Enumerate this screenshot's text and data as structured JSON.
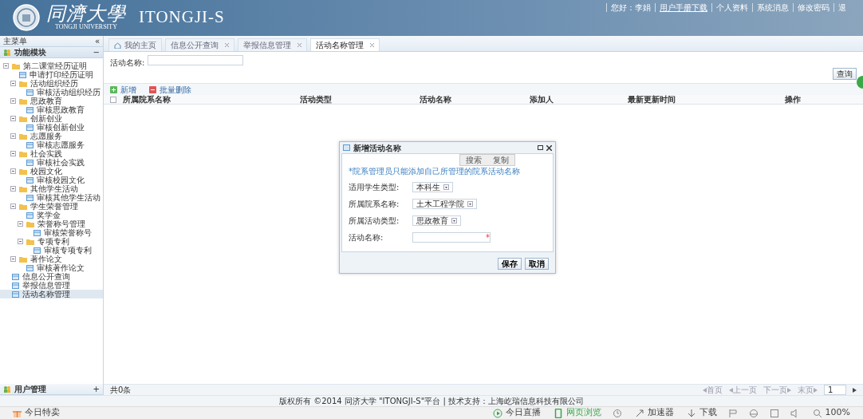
{
  "header": {
    "logo_cn": "同濟大學",
    "logo_en": "TONGJI UNIVERSITY",
    "app_name": "ITONGJI-S",
    "top_links": [
      {
        "text": "您好：李娟",
        "link": false
      },
      {
        "text": "用户手册下载",
        "link": true
      },
      {
        "text": "个人资料",
        "link": false
      },
      {
        "text": "系统消息",
        "link": false
      },
      {
        "text": "修改密码",
        "link": false
      },
      {
        "text": "退",
        "link": false
      }
    ]
  },
  "sidebar": {
    "title": "主菜单",
    "collapse": "«",
    "panels": [
      {
        "title": "功能模块",
        "toggle": "−",
        "expanded": true,
        "tree": [
          {
            "label": "第二课堂经历证明",
            "kind": "folder",
            "expanded": true,
            "selected": false,
            "children": [
              {
                "label": "申请打印经历证明",
                "kind": "leaf",
                "selected": false
              },
              {
                "label": "活动组织经历",
                "kind": "folder",
                "expanded": true,
                "selected": false,
                "children": [
                  {
                    "label": "审核活动组织经历",
                    "kind": "leaf",
                    "selected": false
                  }
                ]
              },
              {
                "label": "思政教育",
                "kind": "folder",
                "expanded": true,
                "selected": false,
                "children": [
                  {
                    "label": "审核思政教育",
                    "kind": "leaf",
                    "selected": false
                  }
                ]
              },
              {
                "label": "创新创业",
                "kind": "folder",
                "expanded": true,
                "selected": false,
                "children": [
                  {
                    "label": "审核创新创业",
                    "kind": "leaf",
                    "selected": false
                  }
                ]
              },
              {
                "label": "志愿服务",
                "kind": "folder",
                "expanded": true,
                "selected": false,
                "children": [
                  {
                    "label": "审核志愿服务",
                    "kind": "leaf",
                    "selected": false
                  }
                ]
              },
              {
                "label": "社会实践",
                "kind": "folder",
                "expanded": true,
                "selected": false,
                "children": [
                  {
                    "label": "审核社会实践",
                    "kind": "leaf",
                    "selected": false
                  }
                ]
              },
              {
                "label": "校园文化",
                "kind": "folder",
                "expanded": true,
                "selected": false,
                "children": [
                  {
                    "label": "审核校园文化",
                    "kind": "leaf",
                    "selected": false
                  }
                ]
              },
              {
                "label": "其他学生活动",
                "kind": "folder",
                "expanded": true,
                "selected": false,
                "children": [
                  {
                    "label": "审核其他学生活动",
                    "kind": "leaf",
                    "selected": false
                  }
                ]
              },
              {
                "label": "学生荣誉管理",
                "kind": "folder",
                "expanded": true,
                "selected": false,
                "children": [
                  {
                    "label": "奖学金",
                    "kind": "leaf",
                    "selected": false
                  },
                  {
                    "label": "荣誉称号管理",
                    "kind": "folder",
                    "expanded": true,
                    "selected": false,
                    "children": [
                      {
                        "label": "审核荣誉称号",
                        "kind": "leaf",
                        "selected": false
                      }
                    ]
                  },
                  {
                    "label": "专项专利",
                    "kind": "folder",
                    "expanded": true,
                    "selected": false,
                    "children": [
                      {
                        "label": "审核专项专利",
                        "kind": "leaf",
                        "selected": false
                      }
                    ]
                  }
                ]
              },
              {
                "label": "著作论文",
                "kind": "folder",
                "expanded": true,
                "selected": false,
                "children": [
                  {
                    "label": "审核著作论文",
                    "kind": "leaf",
                    "selected": false
                  }
                ]
              }
            ]
          },
          {
            "label": "信息公开查询",
            "kind": "leaf",
            "selected": false
          },
          {
            "label": "举报信息管理",
            "kind": "leaf",
            "selected": false
          },
          {
            "label": "活动名称管理",
            "kind": "leaf",
            "selected": true
          }
        ]
      },
      {
        "title": "用户管理",
        "toggle": "+",
        "expanded": false
      }
    ]
  },
  "tabs": [
    {
      "label": "我的主页",
      "kind": "home",
      "selected": false
    },
    {
      "label": "信息公开查询",
      "kind": "closable",
      "selected": false
    },
    {
      "label": "举报信息管理",
      "kind": "closable",
      "selected": false
    },
    {
      "label": "活动名称管理",
      "kind": "closable",
      "selected": true
    }
  ],
  "search": {
    "label": "活动名称:",
    "button": "查询"
  },
  "toolbar": [
    {
      "label": "新增",
      "kind": "add"
    },
    {
      "label": "批量删除",
      "kind": "delete"
    }
  ],
  "table": {
    "select_all_checked": false,
    "columns": [
      "所属院系名称",
      "活动类型",
      "活动名称",
      "添加人",
      "最新更新时间",
      "操作"
    ]
  },
  "pager": {
    "total": "共0条",
    "links": [
      {
        "label": "首页",
        "kind": "first"
      },
      {
        "label": "上一页",
        "kind": "prev"
      },
      {
        "label": "下一页",
        "kind": "next"
      },
      {
        "label": "末页",
        "kind": "last"
      }
    ],
    "page": "1"
  },
  "dialog": {
    "title": "新增活动名称",
    "note": "*院系管理员只能添加自己所管理的院系活动名称",
    "fields": [
      {
        "label": "适用学生类型:",
        "kind": "select",
        "value": "本科生"
      },
      {
        "label": "所属院系名称:",
        "kind": "select",
        "value": "土木工程学院"
      },
      {
        "label": "所属活动类型:",
        "kind": "select",
        "value": "思政教育"
      },
      {
        "label": "活动名称:",
        "kind": "text",
        "required_mark": "*"
      }
    ],
    "buttons": [
      "保存",
      "取消"
    ]
  },
  "popup": [
    "搜索",
    "复制"
  ],
  "footer": "版权所有 ©2014 同济大学 \"ITONGJI-S\"平台 | 技术支持：上海屹瑞信息科技有限公司",
  "status_bar": {
    "left": "今日特卖",
    "items": [
      {
        "kind": "live",
        "label": "今日直播"
      },
      {
        "kind": "phone",
        "label": "网页浏览"
      },
      {
        "kind": "history"
      },
      {
        "kind": "boost",
        "label": "加速器"
      },
      {
        "kind": "download",
        "label": "下载"
      },
      {
        "kind": "flag"
      },
      {
        "kind": "ie"
      },
      {
        "kind": "window"
      },
      {
        "kind": "sound"
      },
      {
        "kind": "zoom",
        "label": "100%"
      }
    ]
  }
}
